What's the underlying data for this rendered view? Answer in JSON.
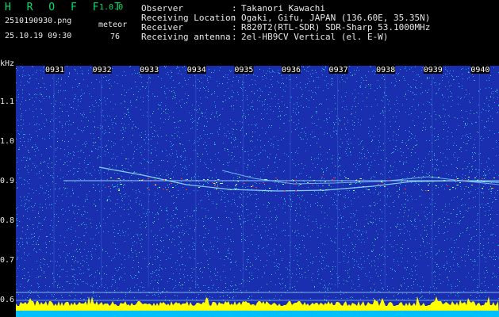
{
  "header": {
    "app_title": "H R O F F T",
    "version": "1.0.0",
    "file_name": "2510190930.png",
    "datetime": "25.10.19 09:30",
    "meteor_label": "meteor",
    "meteor_count": "76"
  },
  "info": [
    {
      "label": "Observer",
      "value": "Takanori Kawachi"
    },
    {
      "label": "Receiving Location",
      "value": "Ogaki, Gifu, JAPAN (136.60E, 35.35N)"
    },
    {
      "label": "Receiver",
      "value": "R820T2(RTL-SDR) SDR-Sharp 53.1000MHz"
    },
    {
      "label": "Receiving antenna",
      "value": "2el-HB9CV Vertical (el. E-W)"
    }
  ],
  "info_separator": ":",
  "spectrogram": {
    "y_unit": "kHz",
    "y_ticks": [
      "1.1",
      "1.0",
      "0.9",
      "0.8",
      "0.7",
      "0.6"
    ],
    "time_ticks": [
      "0931",
      "0932",
      "0933",
      "0934",
      "0935",
      "0936",
      "0937",
      "0938",
      "0939",
      "0940"
    ],
    "colors": {
      "background": "#1a2fb0",
      "noise_speck": "#2fd4e0",
      "noise_bright": "#5ff0a0",
      "tick_label_bg": "#000000",
      "tick_label_text": "#ffffff",
      "carrier_line": "#a8e8ff",
      "meteor_echo": "#ff3030",
      "level_fill": "#ffff00",
      "level_base": "#00c0ff"
    }
  }
}
